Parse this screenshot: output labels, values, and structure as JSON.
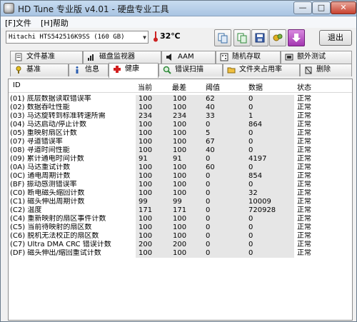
{
  "window": {
    "title": "HD Tune 专业版 v4.01 - 硬盘专业工具",
    "minimize": "—",
    "maximize": "□",
    "close": "✕"
  },
  "menu": [
    {
      "label": "[F]文件"
    },
    {
      "label": "[H]帮助"
    }
  ],
  "toolbar": {
    "drive": "Hitachi HTS542516K9SS    (160 GB)",
    "temperature": "32℃",
    "exit_label": "退出",
    "buttons": [
      {
        "icon": "copy-icon"
      },
      {
        "icon": "copy-info-icon"
      },
      {
        "icon": "save-icon"
      },
      {
        "icon": "options-icon"
      },
      {
        "icon": "download-arrow-icon"
      }
    ]
  },
  "tabs_top": [
    {
      "label": "文件基准",
      "icon": "file-benchmark-icon"
    },
    {
      "label": "磁盘监视器",
      "icon": "disk-monitor-icon"
    },
    {
      "label": "AAM",
      "icon": "speaker-icon"
    },
    {
      "label": "随机存取",
      "icon": "random-access-icon"
    },
    {
      "label": "额外测试",
      "icon": "extra-tests-icon"
    }
  ],
  "tabs_bottom": [
    {
      "label": "基准",
      "icon": "benchmark-icon"
    },
    {
      "label": "信息",
      "icon": "info-icon"
    },
    {
      "label": "健康",
      "icon": "health-cross-icon",
      "active": true
    },
    {
      "label": "错误扫描",
      "icon": "error-scan-icon"
    },
    {
      "label": "文件夹占用率",
      "icon": "folder-icon"
    },
    {
      "label": "删除",
      "icon": "erase-icon"
    }
  ],
  "table": {
    "headers": {
      "id": "ID",
      "current": "当前",
      "worst": "最差",
      "threshold": "阈值",
      "data": "数据",
      "status": "状态"
    },
    "rows": [
      {
        "name": "(01) 底层数据读取错误率",
        "current": "100",
        "worst": "100",
        "threshold": "62",
        "data": "0",
        "status": "正常"
      },
      {
        "name": "(02) 数据吞吐性能",
        "current": "100",
        "worst": "100",
        "threshold": "40",
        "data": "0",
        "status": "正常"
      },
      {
        "name": "(03) 马达旋转到标准转速所需",
        "current": "234",
        "worst": "234",
        "threshold": "33",
        "data": "1",
        "status": "正常"
      },
      {
        "name": "(04) 马达启动/停止计数",
        "current": "100",
        "worst": "100",
        "threshold": "0",
        "data": "864",
        "status": "正常"
      },
      {
        "name": "(05) 重映射扇区计数",
        "current": "100",
        "worst": "100",
        "threshold": "5",
        "data": "0",
        "status": "正常"
      },
      {
        "name": "(07) 寻道错误率",
        "current": "100",
        "worst": "100",
        "threshold": "67",
        "data": "0",
        "status": "正常"
      },
      {
        "name": "(08) 寻道时间性能",
        "current": "100",
        "worst": "100",
        "threshold": "40",
        "data": "0",
        "status": "正常"
      },
      {
        "name": "(09) 累计通电时间计数",
        "current": "91",
        "worst": "91",
        "threshold": "0",
        "data": "4197",
        "status": "正常"
      },
      {
        "name": "(0A) 马达重试计数",
        "current": "100",
        "worst": "100",
        "threshold": "60",
        "data": "0",
        "status": "正常"
      },
      {
        "name": "(0C) 通电周期计数",
        "current": "100",
        "worst": "100",
        "threshold": "0",
        "data": "854",
        "status": "正常"
      },
      {
        "name": "(BF) 振动感测错误率",
        "current": "100",
        "worst": "100",
        "threshold": "0",
        "data": "0",
        "status": "正常"
      },
      {
        "name": "(C0) 断电磁头缩回计数",
        "current": "100",
        "worst": "100",
        "threshold": "0",
        "data": "32",
        "status": "正常"
      },
      {
        "name": "(C1) 磁头伸出周期计数",
        "current": "99",
        "worst": "99",
        "threshold": "0",
        "data": "10009",
        "status": "正常"
      },
      {
        "name": "(C2) 温度",
        "current": "171",
        "worst": "171",
        "threshold": "0",
        "data": "720928",
        "status": "正常"
      },
      {
        "name": "(C4) 重新映射的扇区事件计数",
        "current": "100",
        "worst": "100",
        "threshold": "0",
        "data": "0",
        "status": "正常"
      },
      {
        "name": "(C5) 当前待映射的扇区数",
        "current": "100",
        "worst": "100",
        "threshold": "0",
        "data": "0",
        "status": "正常"
      },
      {
        "name": "(C6) 脱机无法校正的扇区数",
        "current": "100",
        "worst": "100",
        "threshold": "0",
        "data": "0",
        "status": "正常"
      },
      {
        "name": "(C7) Ultra DMA CRC 错误计数",
        "current": "200",
        "worst": "200",
        "threshold": "0",
        "data": "0",
        "status": "正常"
      },
      {
        "name": "(DF) 磁头伸出/缩回重试计数",
        "current": "100",
        "worst": "100",
        "threshold": "0",
        "data": "0",
        "status": "正常"
      }
    ]
  },
  "colors": {
    "title_bar": "#a9c4e2",
    "close_button": "#c8412f",
    "cell_shade": "#e6e6e6",
    "health_cross": "#d21f1f"
  }
}
